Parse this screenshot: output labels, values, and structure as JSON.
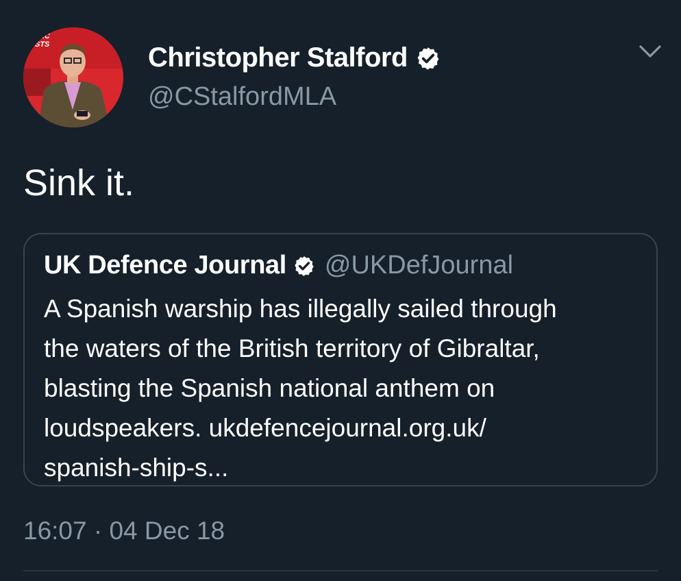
{
  "author": {
    "display_name": "Christopher Stalford",
    "handle": "@CStalfordMLA",
    "verified": true,
    "avatar_sign_text": "ATIC\nNISTS"
  },
  "tweet": {
    "text": "Sink it.",
    "timestamp": "16:07 · 04 Dec 18"
  },
  "quoted_tweet": {
    "display_name": "UK Defence Journal",
    "handle": "@UKDefJournal",
    "verified": true,
    "body_lines": [
      "A Spanish warship has illegally sailed through",
      "the waters of the British territory of Gibraltar,",
      "blasting the Spanish national anthem on",
      "loudspeakers. ukdefencejournal.org.uk/",
      "spanish-ship-s..."
    ]
  },
  "icons": {
    "verified": "verified-badge-icon",
    "menu": "chevron-down-icon"
  },
  "colors": {
    "background": "#16202b",
    "text_primary": "#ffffff",
    "text_secondary": "#8899a6",
    "border": "#38444d",
    "avatar_red": "#d8272d"
  }
}
